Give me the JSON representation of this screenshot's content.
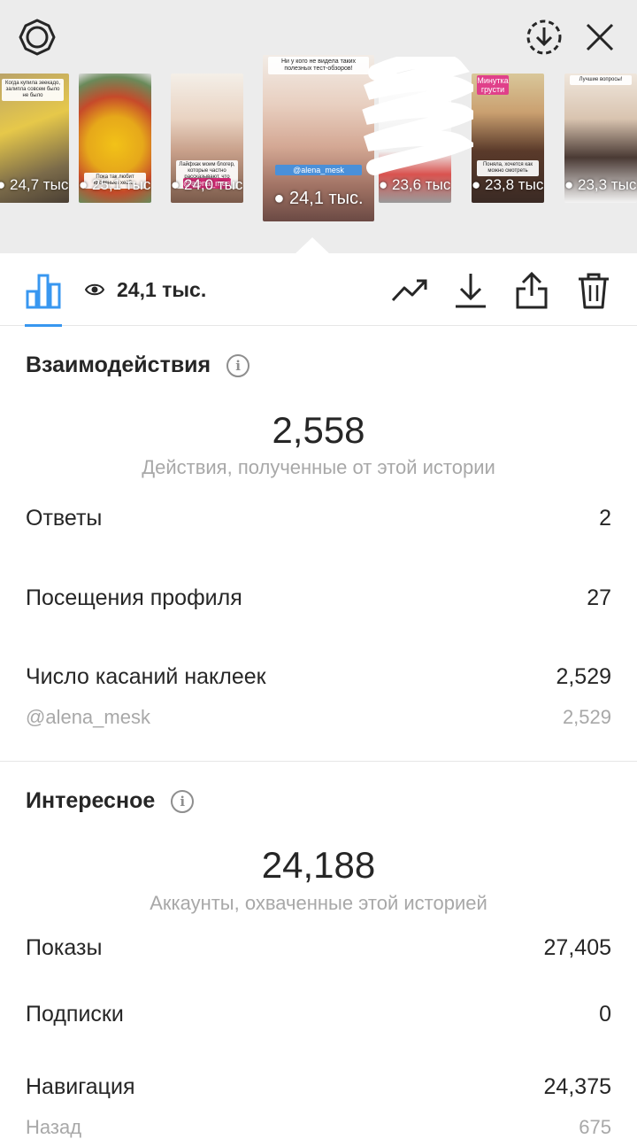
{
  "top_bar": {
    "left_icon": "settings-circle-icon",
    "download_icon": "download-circle-icon",
    "close_icon": "close-icon"
  },
  "stories": [
    {
      "views": "24,7 тыс.",
      "caption": "Когда купила зеекадо, залипла совсем было не было"
    },
    {
      "views": "25,1 тыс.",
      "caption": "Пока так любит кровенька хеей..."
    },
    {
      "views": "24,0 тыс.",
      "caption": "Лайфхак моим блогер, которые частно рассказывают, что покупать НЕ НАДО",
      "tag": "@alena_mesk"
    },
    {
      "views": "24,1 тыс.",
      "caption": "Ни у кого не видела таких полезных тест-обзоров!",
      "tag": "@alena_mesk",
      "active": true
    },
    {
      "views": "23,6 тыс.",
      "caption": ""
    },
    {
      "views": "23,8 тыс.",
      "caption": "Поняла, хочется как можно смотреть",
      "badge": "Минутка грусти"
    },
    {
      "views": "23,3 тыс.",
      "caption": "Лучшие вопросы!"
    }
  ],
  "toolbar": {
    "views_value": "24,1 тыс.",
    "icons": [
      "bar-chart-icon",
      "eye-icon",
      "trend-icon",
      "download-icon",
      "share-icon",
      "trash-icon"
    ]
  },
  "interactions": {
    "title": "Взаимодействия",
    "total": "2,558",
    "total_caption": "Действия, полученные от этой истории",
    "rows": [
      {
        "label": "Ответы",
        "value": "2"
      },
      {
        "label": "Посещения профиля",
        "value": "27"
      },
      {
        "label": "Число касаний наклеек",
        "value": "2,529"
      }
    ],
    "sub_row": {
      "label": "@alena_mesk",
      "value": "2,529"
    }
  },
  "discovery": {
    "title": "Интересное",
    "total": "24,188",
    "total_caption": "Аккаунты, охваченные этой историей",
    "rows": [
      {
        "label": "Показы",
        "value": "27,405"
      },
      {
        "label": "Подписки",
        "value": "0"
      },
      {
        "label": "Навигация",
        "value": "24,375"
      }
    ],
    "sub_row": {
      "label": "Назад",
      "value": "675"
    }
  },
  "colors": {
    "accent": "#3897f0",
    "text": "#262626",
    "muted": "#a8a8a8",
    "top_bg": "#ececec"
  }
}
